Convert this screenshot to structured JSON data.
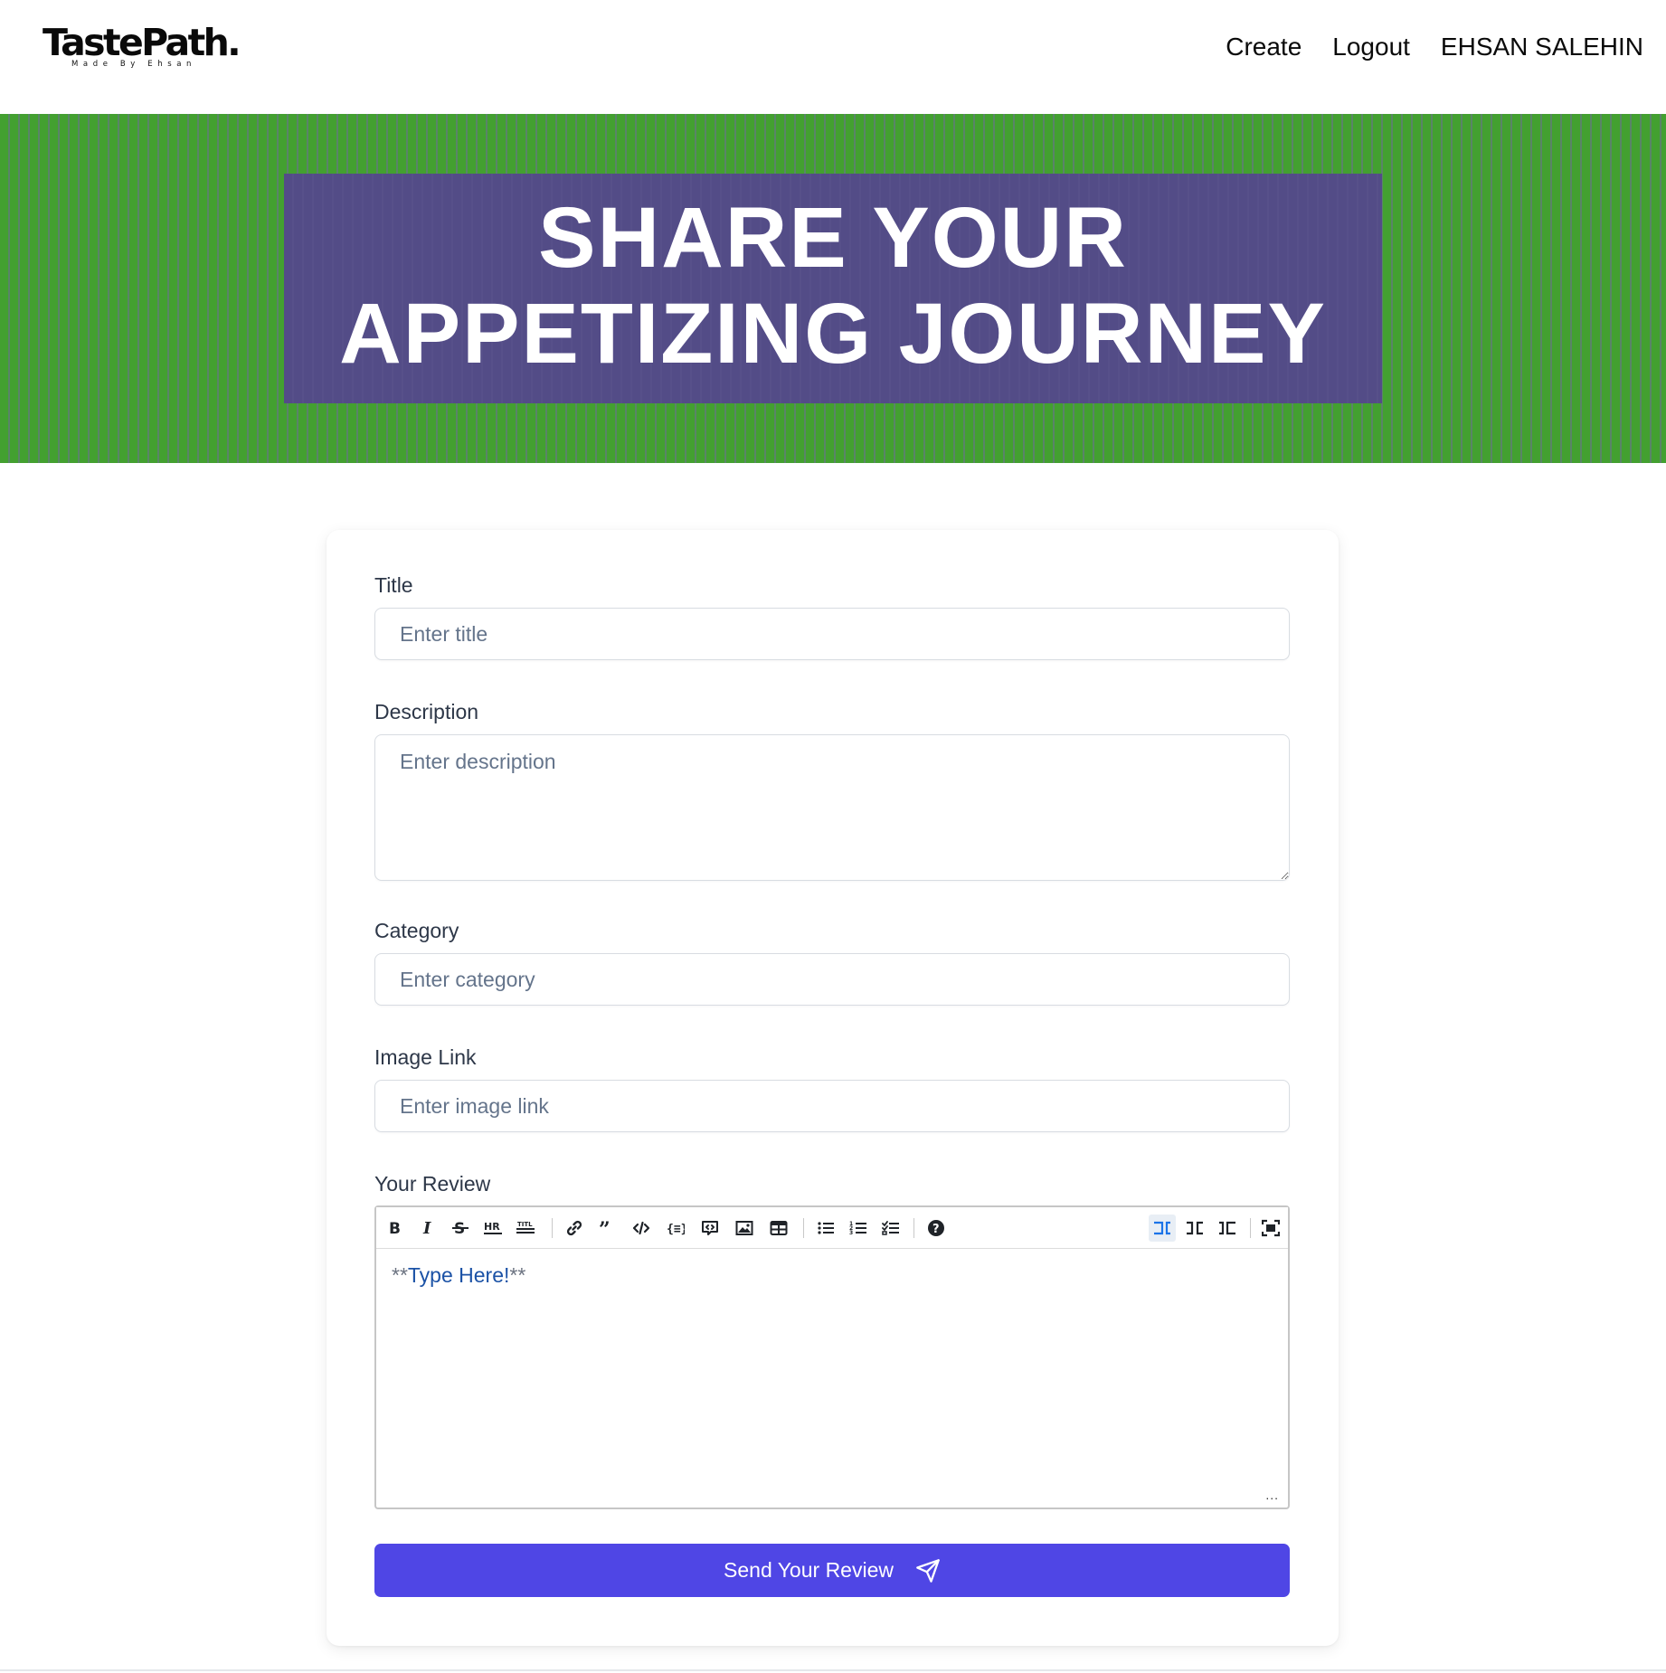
{
  "brand": {
    "name": "TastePath.",
    "tagline": "Made By Ehsan"
  },
  "nav": {
    "create": "Create",
    "logout": "Logout",
    "user": "EHSAN SALEHIN"
  },
  "hero": {
    "line1": "SHARE YOUR",
    "line2": "APPETIZING JOURNEY"
  },
  "form": {
    "title": {
      "label": "Title",
      "placeholder": "Enter title",
      "value": ""
    },
    "description": {
      "label": "Description",
      "placeholder": "Enter description",
      "value": ""
    },
    "category": {
      "label": "Category",
      "placeholder": "Enter category",
      "value": ""
    },
    "image_link": {
      "label": "Image Link",
      "placeholder": "Enter image link",
      "value": ""
    },
    "review": {
      "label": "Your Review",
      "content_prefix": "**",
      "content_text": "Type Here!",
      "content_suffix": "**",
      "drag_handle": "...",
      "toolbar": [
        "bold-icon",
        "italic-icon",
        "strikethrough-icon",
        "hr-icon",
        "title-icon",
        "link-icon",
        "quote-icon",
        "code-icon",
        "code-block-icon",
        "comment-icon",
        "image-icon",
        "table-icon",
        "unordered-list-icon",
        "ordered-list-icon",
        "checklist-icon",
        "help-icon",
        "edit-mode-icon",
        "live-mode-icon",
        "preview-mode-icon",
        "fullscreen-icon"
      ]
    },
    "submit_label": "Send Your Review"
  },
  "colors": {
    "hero_green": "#43a030",
    "hero_box": "#534c87",
    "primary_button": "#4f46e5",
    "review_text": "#1b52a6"
  }
}
